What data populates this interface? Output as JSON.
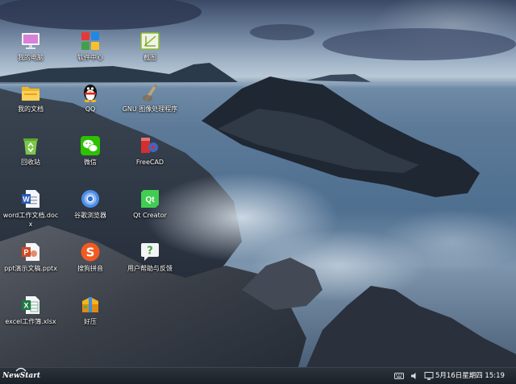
{
  "desktop": {
    "icons": [
      {
        "label": "我的电脑",
        "icon": "computer-icon"
      },
      {
        "label": "软件中心",
        "icon": "software-center-icon"
      },
      {
        "label": "截图",
        "icon": "screenshot-icon"
      },
      {
        "label": "我的文档",
        "icon": "folder-icon"
      },
      {
        "label": "QQ",
        "icon": "qq-penguin-icon"
      },
      {
        "label": "GNU 图像处理程序",
        "icon": "gimp-icon"
      },
      {
        "label": "回收站",
        "icon": "recycle-bin-icon"
      },
      {
        "label": "微信",
        "icon": "wechat-icon"
      },
      {
        "label": "FreeCAD",
        "icon": "freecad-icon"
      },
      {
        "label": "word工作文档.docx",
        "icon": "word-document-icon"
      },
      {
        "label": "谷歌浏览器",
        "icon": "chrome-browser-icon"
      },
      {
        "label": "Qt Creator",
        "icon": "qt-creator-icon"
      },
      {
        "label": "ppt演示文稿.pptx",
        "icon": "powerpoint-icon"
      },
      {
        "label": "搜狗拼音",
        "icon": "sogou-pinyin-icon"
      },
      {
        "label": "用户帮助与反馈",
        "icon": "help-feedback-icon"
      },
      {
        "label": "excel工作簿.xlsx",
        "icon": "excel-icon"
      },
      {
        "label": "好压",
        "icon": "haozip-icon"
      }
    ]
  },
  "taskbar": {
    "start_label": "NewStart",
    "tray": [
      {
        "icon": "keyboard-icon"
      },
      {
        "icon": "volume-icon"
      },
      {
        "icon": "network-icon"
      }
    ],
    "clock": "5月16日星期四 15:19"
  },
  "colors": {
    "taskbar": "#1f262e",
    "label_text": "#ffffff"
  }
}
